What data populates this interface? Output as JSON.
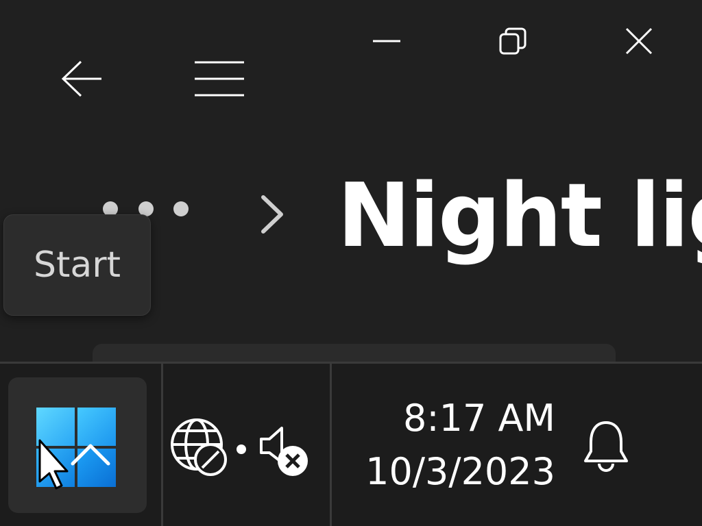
{
  "window": {
    "caption_buttons": {
      "minimize_icon": "minimize-icon",
      "restore_icon": "restore-icon",
      "close_icon": "close-icon"
    },
    "nav": {
      "back_icon": "back-arrow-icon",
      "menu_icon": "hamburger-menu-icon"
    }
  },
  "breadcrumb": {
    "more_icon": "ellipsis-icon",
    "separator_icon": "chevron-right-icon",
    "page_title": "Night lig"
  },
  "tooltip": {
    "text": "Start"
  },
  "taskbar": {
    "start_icon": "windows-logo-icon",
    "overflow_icon": "chevron-up-icon",
    "tray": {
      "network_icon": "network-no-internet-icon",
      "volume_icon": "volume-muted-icon"
    },
    "clock": {
      "time": "8:17 AM",
      "date": "10/3/2023"
    },
    "notification_icon": "bell-icon"
  },
  "colors": {
    "background": "#202020",
    "taskbar": "#1c1c1c",
    "accent": "#1e9df7",
    "text": "#ffffff"
  }
}
